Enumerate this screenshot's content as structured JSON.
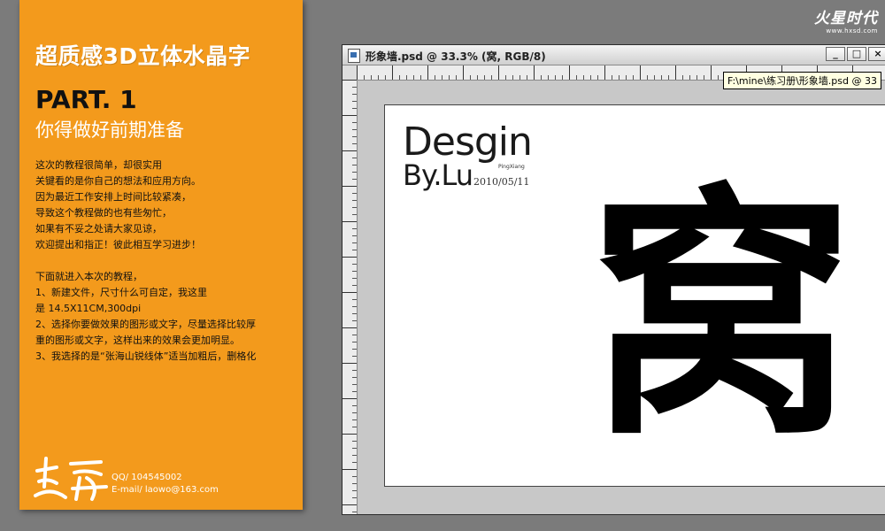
{
  "tutorial": {
    "title": "超质感3D立体水晶字",
    "part": "PART. 1",
    "subtitle": "你得做好前期准备",
    "intro_lines": [
      "这次的教程很简单，却很实用",
      "关键看的是你自己的想法和应用方向。",
      "因为最近工作安排上时间比较紧凑，",
      "导致这个教程做的也有些匆忙，",
      "如果有不妥之处请大家见谅，",
      "欢迎提出和指正！彼此相互学习进步！"
    ],
    "steps_lines": [
      "下面就进入本次的教程，",
      "1、新建文件，尺寸什么可自定，我这里",
      "是 14.5X11CM,300dpi",
      "2、选择你要做效果的图形或文字，尽量选择比较厚",
      "重的图形或文字，这样出来的效果会更加明显。",
      "3、我选择的是“张海山锐线体”适当加粗后，删格化"
    ],
    "qq": "QQ/ 104545002",
    "email": "E-mail/ laowo@163.com"
  },
  "watermark": {
    "mark": "火星时代",
    "url": "www.hxsd.com"
  },
  "photoshop_window": {
    "title": "形象墙.psd @ 33.3% (窝, RGB/8)",
    "tooltip": "F:\\mine\\练习册\\形象墙.psd @ 33",
    "buttons": {
      "minimize": "_",
      "maximize": "□",
      "close": "×"
    },
    "canvas": {
      "brand_word": "Desgin",
      "brand_by": "By.Lu",
      "brand_small": "PingXiang",
      "date": "2010/05/11",
      "big_char": "窝"
    }
  },
  "colors": {
    "panel_orange": "#f39a1c",
    "background_gray": "#7b7b7b"
  }
}
